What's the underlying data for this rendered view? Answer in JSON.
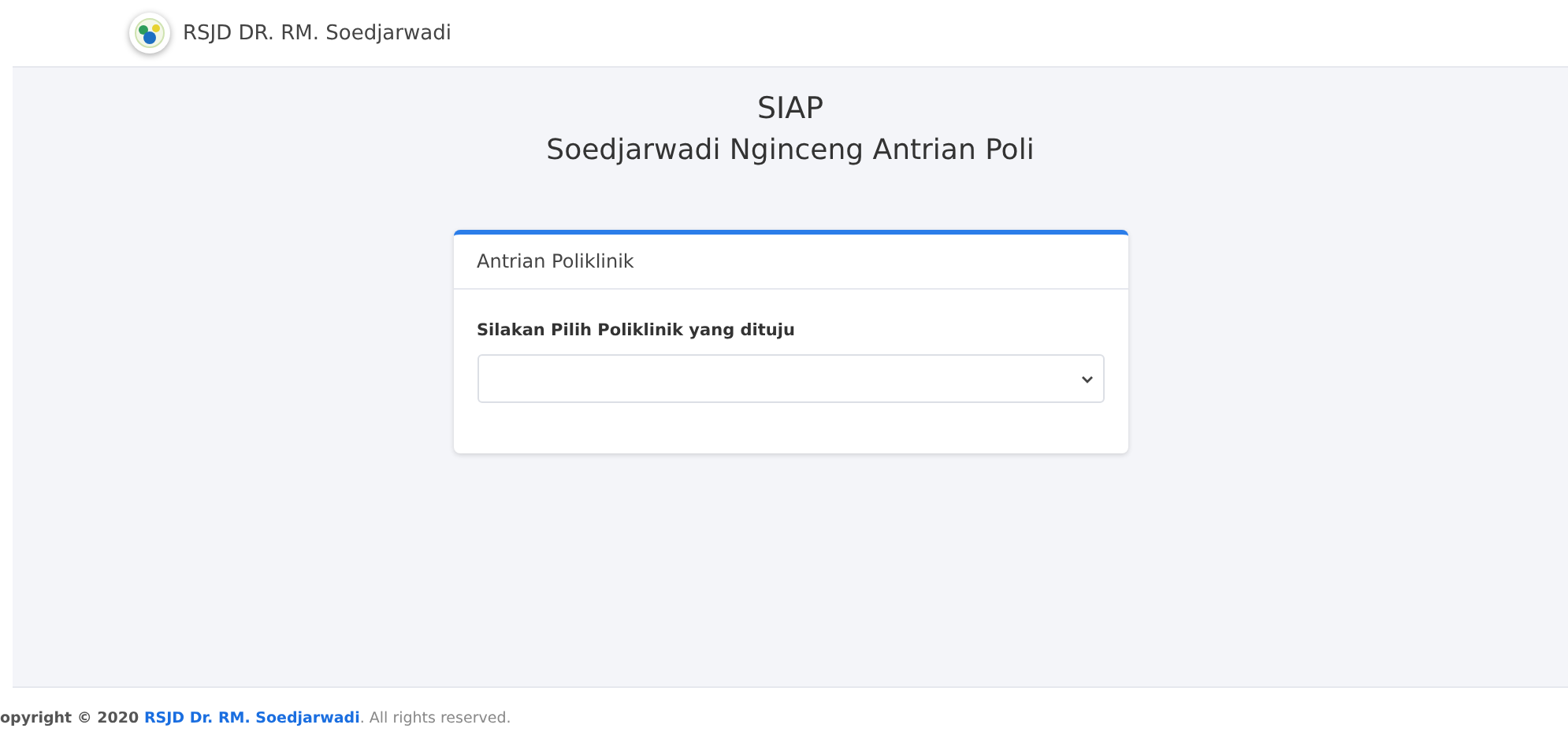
{
  "header": {
    "brand": "RSJD DR. RM. Soedjarwadi"
  },
  "hero": {
    "title": "SIAP",
    "subtitle": "Soedjarwadi Nginceng Antrian Poli"
  },
  "card": {
    "title": "Antrian Poliklinik",
    "label": "Silakan Pilih Poliklinik yang dituju"
  },
  "footer": {
    "prefix": "opyright © 2020 ",
    "link": "RSJD Dr. RM. Soedjarwadi",
    "suffix": ". All rights reserved."
  }
}
